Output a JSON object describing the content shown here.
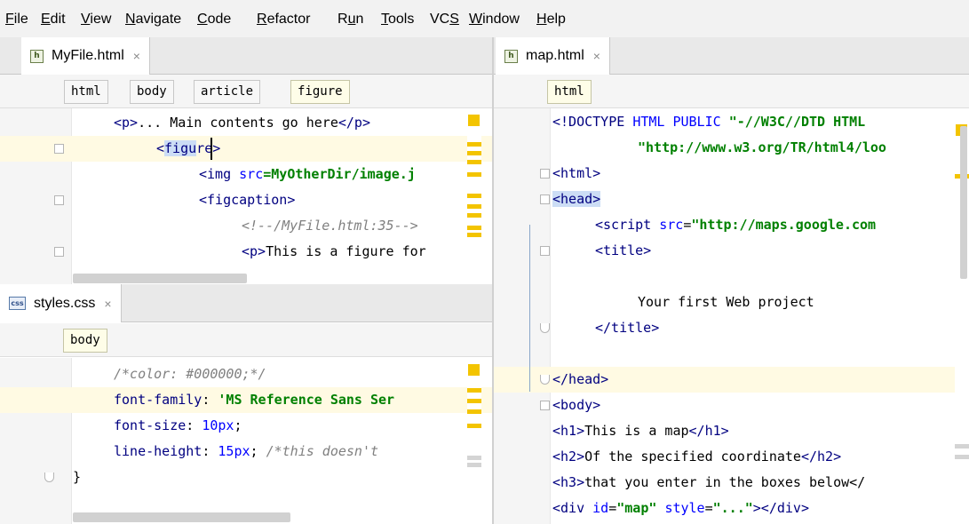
{
  "menu": {
    "items": [
      {
        "pre": "",
        "u": "F",
        "post": "ile"
      },
      {
        "pre": "",
        "u": "E",
        "post": "dit"
      },
      {
        "pre": "",
        "u": "V",
        "post": "iew"
      },
      {
        "pre": "",
        "u": "N",
        "post": "avigate"
      },
      {
        "pre": "",
        "u": "C",
        "post": "ode"
      },
      {
        "pre": "",
        "u": "R",
        "post": "efactor"
      },
      {
        "pre": "R",
        "u": "u",
        "post": "n"
      },
      {
        "pre": "",
        "u": "T",
        "post": "ools"
      },
      {
        "pre": "VC",
        "u": "S",
        "post": ""
      },
      {
        "pre": "",
        "u": "W",
        "post": "indow"
      },
      {
        "pre": "",
        "u": "H",
        "post": "elp"
      }
    ]
  },
  "left_top": {
    "tab": {
      "label": "MyFile.html",
      "icon": "html-file-icon",
      "close": "×"
    },
    "breadcrumbs": [
      "html",
      "body",
      "article",
      "figure"
    ],
    "lines": [
      [
        [
          "",
          "<p>",
          "tag"
        ],
        [
          "",
          "... Main contents go here",
          ""
        ],
        [
          "",
          "</p>",
          "tag"
        ]
      ],
      [
        [
          "",
          "<",
          "tag"
        ],
        [
          "",
          "figu",
          "tag"
        ],
        [
          "",
          "r",
          "tag"
        ],
        [
          "",
          "e>",
          "tag"
        ]
      ],
      [
        [
          "",
          "<img ",
          "tag"
        ],
        [
          "",
          "src",
          "attr"
        ],
        [
          "",
          "=MyOtherDir/image.j",
          "str"
        ]
      ],
      [
        [
          "",
          "<figcaption>",
          "tag"
        ]
      ],
      [
        [
          "",
          "<!--/MyFile.html:35-->",
          "cmt"
        ]
      ],
      [
        [
          "",
          "<p>",
          "tag"
        ],
        [
          "",
          "This is a figure for",
          ""
        ]
      ]
    ]
  },
  "left_bottom": {
    "tab": {
      "label": "styles.css",
      "icon": "css-file-icon",
      "close": "×"
    },
    "breadcrumbs": [
      "body"
    ],
    "lines": [
      [
        [
          "",
          "/*color: #000000;*/",
          "cmt"
        ]
      ],
      [
        [
          "",
          "font-family",
          "prop"
        ],
        [
          "",
          ": ",
          ""
        ],
        [
          "",
          "'MS Reference Sans Ser",
          "str"
        ]
      ],
      [
        [
          "",
          "font-size",
          "prop"
        ],
        [
          "",
          ": ",
          ""
        ],
        [
          "",
          "10px",
          "val"
        ],
        [
          "",
          ";",
          ""
        ]
      ],
      [
        [
          "",
          "line-height",
          "prop"
        ],
        [
          "",
          ": ",
          ""
        ],
        [
          "",
          "15px",
          "val"
        ],
        [
          "",
          "; ",
          ""
        ],
        [
          "",
          "/*this doesn't",
          "cmt"
        ]
      ],
      [
        [
          "",
          "}",
          ""
        ]
      ]
    ]
  },
  "right": {
    "tab": {
      "label": "map.html",
      "icon": "html-file-icon",
      "close": "×"
    },
    "breadcrumbs": [
      "html"
    ],
    "lines": [
      [
        [
          "",
          "<!DOCTYPE ",
          "tag"
        ],
        [
          "",
          "HTML PUBLIC ",
          "attr"
        ],
        [
          "",
          "\"-//W3C//DTD HTML",
          "str"
        ]
      ],
      [
        [
          "",
          "\"http://www.w3.org/TR/html4/loo",
          "str"
        ]
      ],
      [
        [
          "",
          "<html>",
          "tag"
        ]
      ],
      [
        [
          "",
          "<head>",
          "tag"
        ]
      ],
      [
        [
          "",
          "<script ",
          "tag"
        ],
        [
          "",
          "src",
          "attr"
        ],
        [
          "",
          "=",
          ""
        ],
        [
          "",
          "\"http://maps.google.com",
          "str"
        ]
      ],
      [
        [
          "",
          "<title>",
          "tag"
        ]
      ],
      [
        [
          "",
          "",
          ""
        ]
      ],
      [
        [
          "",
          "Your first Web project",
          ""
        ]
      ],
      [
        [
          "",
          "</title>",
          "tag"
        ]
      ],
      [
        [
          "",
          "",
          ""
        ]
      ],
      [
        [
          "",
          "</head>",
          "tag"
        ]
      ],
      [
        [
          "",
          "<body>",
          "tag"
        ]
      ],
      [
        [
          "",
          "<h1>",
          "tag"
        ],
        [
          "",
          "This is a map",
          ""
        ],
        [
          "",
          "</h1>",
          "tag"
        ]
      ],
      [
        [
          "",
          "<h2>",
          "tag"
        ],
        [
          "",
          "Of the specified coordinate",
          ""
        ],
        [
          "",
          "</h2>",
          "tag"
        ]
      ],
      [
        [
          "",
          "<h3>",
          "tag"
        ],
        [
          "",
          "that you enter in the boxes below</",
          ""
        ]
      ],
      [
        [
          "",
          "<div ",
          "tag"
        ],
        [
          "",
          "id",
          "attr"
        ],
        [
          "",
          "=",
          ""
        ],
        [
          "",
          "\"map\" ",
          "str"
        ],
        [
          "",
          "style",
          "attr"
        ],
        [
          "",
          "=",
          ""
        ],
        [
          "",
          "\"...\"",
          "str"
        ],
        [
          "",
          "></div>",
          "tag"
        ]
      ]
    ]
  }
}
